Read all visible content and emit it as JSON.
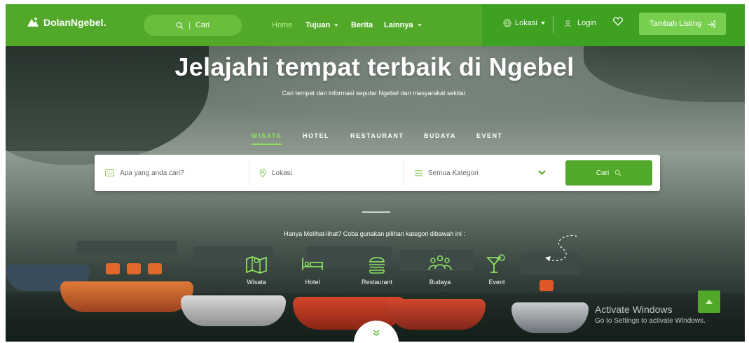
{
  "navbar": {
    "logo_text": "DolanNgebel.",
    "search_label": "Cari",
    "links": [
      {
        "label": "Home"
      },
      {
        "label": "Tujuan"
      },
      {
        "label": "Berita"
      },
      {
        "label": "Lainnya"
      }
    ],
    "lokasi_label": "Lokasi",
    "login_label": "Login",
    "tambah_label": "Tambah Listing"
  },
  "hero": {
    "title": "Jelajahi tempat terbaik di Ngebel",
    "subtitle": "Cari tempat dan informasi seputar Ngebel dari masyarakat sekitar.",
    "tabs": [
      "WISATA",
      "HOTEL",
      "RESTAURANT",
      "BUDAYA",
      "EVENT"
    ],
    "active_tab": "WISATA"
  },
  "search": {
    "keyword_placeholder": "Apa yang anda cari?",
    "location_placeholder": "Lokasi",
    "category_value": "Semua Kategori",
    "submit_label": "Cari"
  },
  "categories": {
    "hint": "Hanya Melihat-lihat? Coba gunakan pilihan kategori dibawah ini :",
    "items": [
      {
        "label": "Wisata",
        "icon": "map-icon"
      },
      {
        "label": "Hotel",
        "icon": "bed-icon"
      },
      {
        "label": "Restaurant",
        "icon": "burger-icon"
      },
      {
        "label": "Budaya",
        "icon": "people-icon"
      },
      {
        "label": "Event",
        "icon": "cocktail-icon"
      }
    ]
  },
  "overlay": {
    "activate_title": "Activate Windows",
    "activate_sub": "Go to Settings to activate Windows."
  },
  "colors": {
    "brand_green": "#52a929",
    "nav_right_green": "#3ea122",
    "button_light_green": "#78cf4f",
    "active_tab_green": "#8de060"
  }
}
